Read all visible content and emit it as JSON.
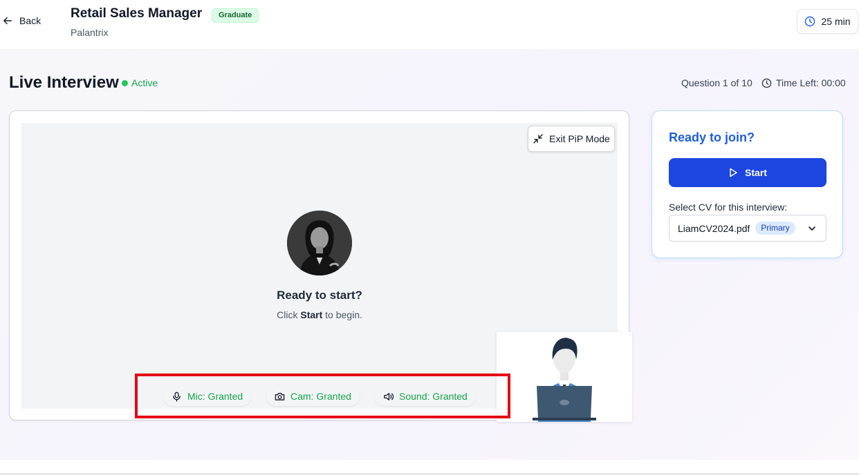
{
  "header": {
    "back_label": "Back",
    "job_title": "Retail Sales Manager",
    "level_badge": "Graduate",
    "company": "Palantrix",
    "duration": "25 min"
  },
  "interview": {
    "heading": "Live Interview",
    "status": "Active",
    "question_counter": "Question 1 of 10",
    "time_left": "Time Left: 00:00"
  },
  "video": {
    "pip_button": "Exit PiP Mode",
    "ready_title": "Ready to start?",
    "ready_sub_prefix": "Click ",
    "ready_sub_bold": "Start",
    "ready_sub_suffix": " to begin."
  },
  "join": {
    "title": "Ready to join?",
    "start_label": "Start",
    "cv_label": "Select CV for this interview:",
    "cv_selected": "LiamCV2024.pdf",
    "cv_badge": "Primary"
  },
  "permissions": {
    "mic": "Mic: Granted",
    "cam": "Cam: Granted",
    "sound": "Sound: Granted"
  },
  "colors": {
    "accent": "#1d46e0",
    "success": "#16a34a",
    "highlight": "#e50914"
  }
}
